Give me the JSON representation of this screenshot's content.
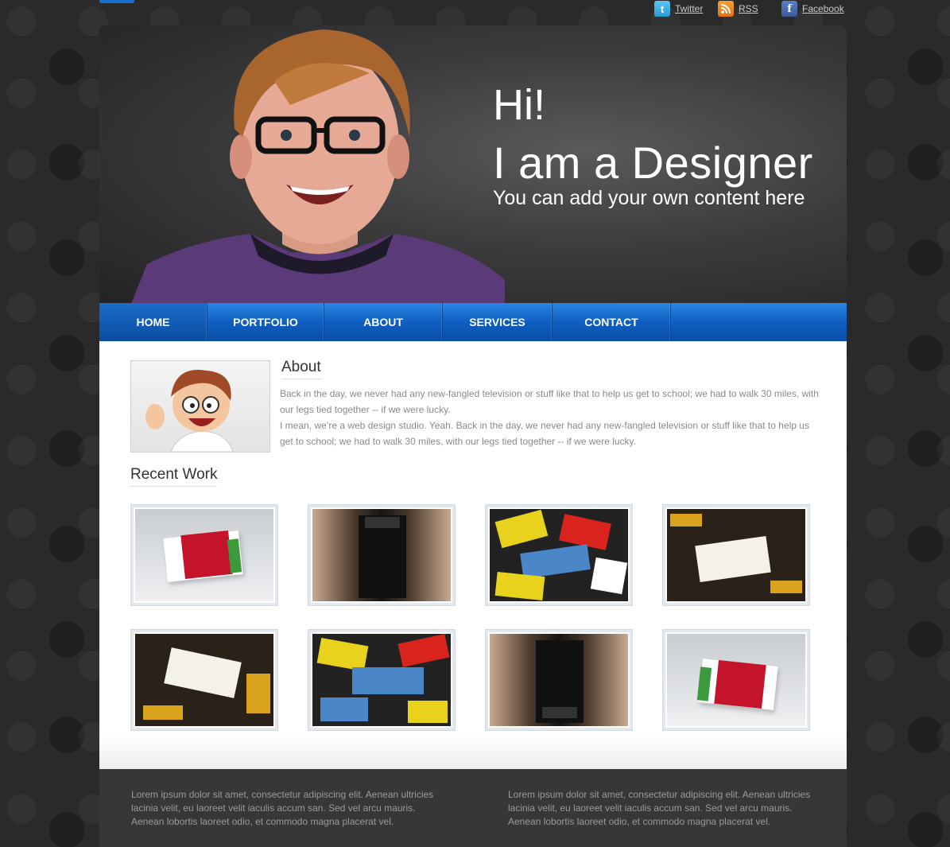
{
  "social": {
    "twitter_label": "Twitter",
    "rss_label": "RSS",
    "facebook_label": "Facebook"
  },
  "hero": {
    "greeting": "Hi!",
    "title": "I am a Designer",
    "subtitle": "You can add your own content here"
  },
  "nav": {
    "items": [
      "HOME",
      "PORTFOLIO",
      "ABOUT",
      "SERVICES",
      "CONTACT"
    ],
    "active": "HOME"
  },
  "about": {
    "title": "About",
    "paragraph_1": "Back in the day, we never had any new-fangled television or stuff like that to help us get to school; we had to walk 30 miles, with our legs tied together -- if we were lucky.",
    "paragraph_2": "I mean, we’re a web design studio. Yeah. Back in the day, we never had any new-fangled television or stuff like that to help us get to school; we had to walk 30 miles, with our legs tied together -- if we were lucky."
  },
  "recent_work": {
    "title": "Recent Work"
  },
  "footer": {
    "col_1": "Lorem ipsum dolor sit amet, consectetur adipiscing elit. Aenean ultricies lacinia velit, eu laoreet velit iaculis accum san. Sed vel arcu mauris. Aenean lobortis laoreet odio, et commodo magna placerat vel.",
    "col_2": "Lorem ipsum dolor sit amet, consectetur adipiscing elit. Aenean ultricies lacinia velit, eu laoreet velit iaculis accum san. Sed vel arcu mauris. Aenean lobortis laoreet odio, et commodo magna placerat vel."
  },
  "colors": {
    "nav_blue": "#0f5fc2",
    "page_bg": "#2a2a2a",
    "footer_bg": "#373737"
  }
}
